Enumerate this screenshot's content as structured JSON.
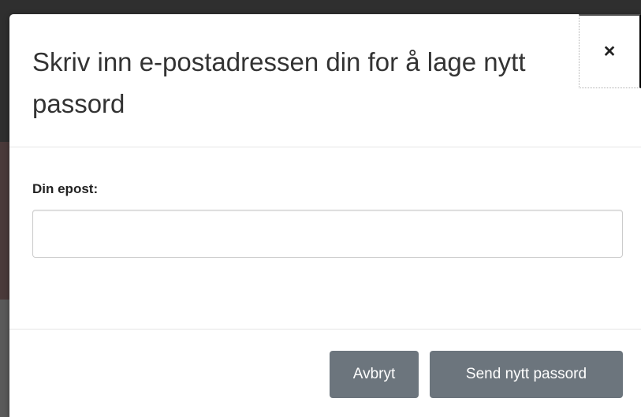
{
  "dialog": {
    "title": "Skriv inn e-postadressen din for å lage nytt passord",
    "close_label": "×"
  },
  "form": {
    "email_label": "Din epost:",
    "email_value": "",
    "email_placeholder": ""
  },
  "footer": {
    "cancel_label": "Avbryt",
    "send_label": "Send nytt passord"
  },
  "colors": {
    "button_bg": "#6c757d",
    "button_text": "#ffffff",
    "title_text": "#333333"
  }
}
